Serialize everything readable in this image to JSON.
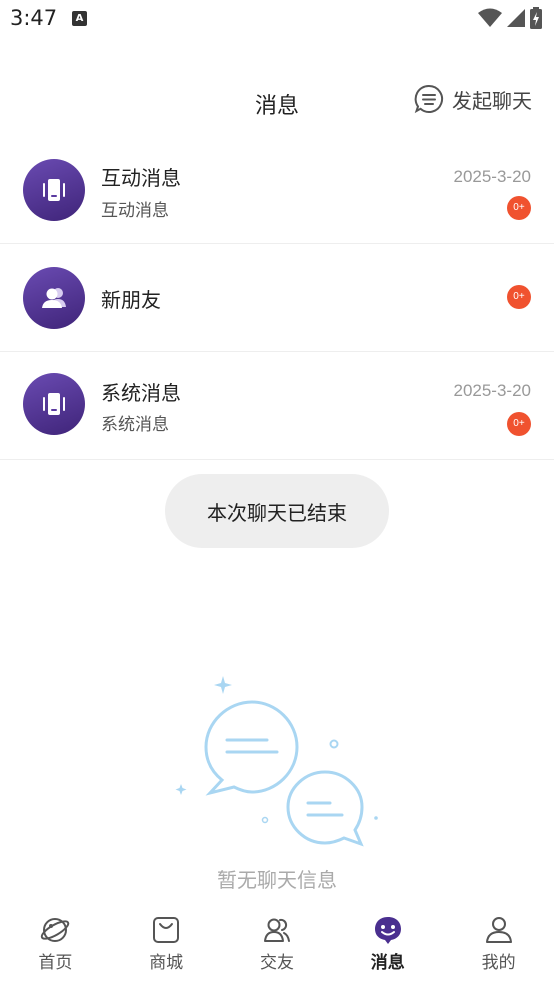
{
  "status_bar": {
    "time": "3:47",
    "notification_icon": "A"
  },
  "header": {
    "title": "消息",
    "start_chat_label": "发起聊天",
    "start_chat_icon": "chat-bubble-lines-icon"
  },
  "rows": [
    {
      "title": "互动消息",
      "subtitle": "互动消息",
      "date": "2025-3-20",
      "badge": "0+",
      "icon": "phone-vibrate-icon"
    },
    {
      "title": "新朋友",
      "subtitle": "",
      "date": "",
      "badge": "0+",
      "icon": "users-icon"
    },
    {
      "title": "系统消息",
      "subtitle": "系统消息",
      "date": "2025-3-20",
      "badge": "0+",
      "icon": "phone-vibrate-icon"
    }
  ],
  "toast": {
    "text": "本次聊天已结束"
  },
  "empty_state": {
    "text": "暂无聊天信息"
  },
  "bottom_nav": {
    "active_index": 3,
    "items": [
      {
        "label": "首页",
        "icon": "planet-icon"
      },
      {
        "label": "商城",
        "icon": "shopping-bag-icon"
      },
      {
        "label": "交友",
        "icon": "friends-icon"
      },
      {
        "label": "消息",
        "icon": "message-face-icon"
      },
      {
        "label": "我的",
        "icon": "person-icon"
      }
    ]
  },
  "colors": {
    "accent": "#4a2f8f",
    "badge": "#f0522f",
    "illustration": "#a9d6f2",
    "toast_bg": "#eeeeee"
  }
}
